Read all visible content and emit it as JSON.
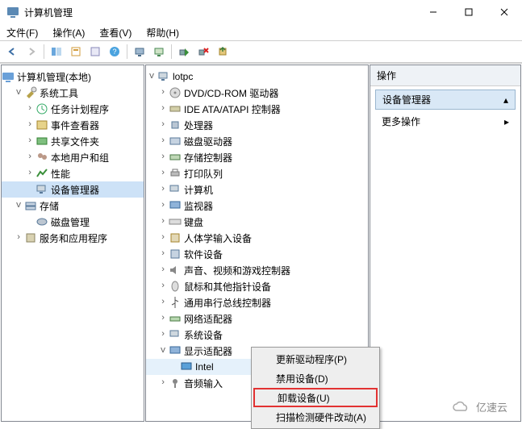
{
  "window": {
    "title": "计算机管理"
  },
  "menu": {
    "file": "文件(F)",
    "action": "操作(A)",
    "view": "查看(V)",
    "help": "帮助(H)"
  },
  "left_tree": {
    "root": "计算机管理(本地)",
    "groups": [
      {
        "label": "系统工具",
        "expanded": true,
        "children": [
          {
            "label": "任务计划程序"
          },
          {
            "label": "事件查看器"
          },
          {
            "label": "共享文件夹"
          },
          {
            "label": "本地用户和组"
          },
          {
            "label": "性能"
          },
          {
            "label": "设备管理器",
            "selected": true
          }
        ]
      },
      {
        "label": "存储",
        "expanded": true,
        "children": [
          {
            "label": "磁盘管理"
          }
        ]
      },
      {
        "label": "服务和应用程序",
        "expanded": false,
        "children": []
      }
    ]
  },
  "device_tree": {
    "root": "lotpc",
    "items": [
      "DVD/CD-ROM 驱动器",
      "IDE ATA/ATAPI 控制器",
      "处理器",
      "磁盘驱动器",
      "存储控制器",
      "打印队列",
      "计算机",
      "监视器",
      "键盘",
      "人体学输入设备",
      "软件设备",
      "声音、视频和游戏控制器",
      "鼠标和其他指针设备",
      "通用串行总线控制器",
      "网络适配器",
      "系统设备"
    ],
    "display_adapter": {
      "label": "显示适配器",
      "child": "Intel"
    },
    "audio": "音频输入"
  },
  "right_panel": {
    "header": "操作",
    "section": "设备管理器",
    "more": "更多操作"
  },
  "context_menu": {
    "update": "更新驱动程序(P)",
    "disable": "禁用设备(D)",
    "uninstall": "卸载设备(U)",
    "scan": "扫描检测硬件改动(A)"
  },
  "watermark": "亿速云"
}
